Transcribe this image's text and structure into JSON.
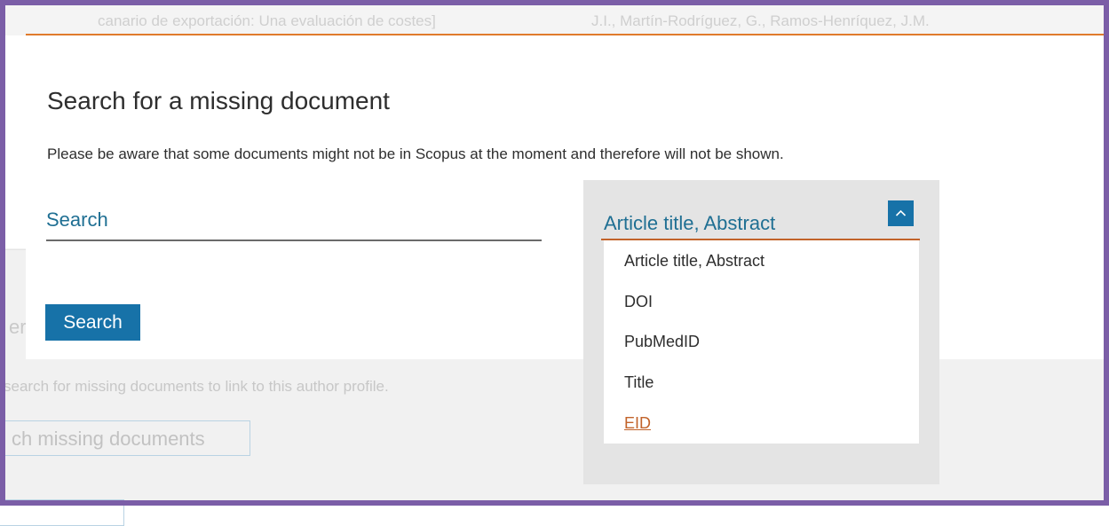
{
  "background": {
    "row_cells": [
      "canario de exportación: Una evaluación de costes]",
      "J.I., Martín-Rodríguez, G., Ramos-Henríquez, J.M."
    ],
    "heading_fragment": "er",
    "description": "search for missing documents to link to this author profile.",
    "button_label": "ch missing documents"
  },
  "modal": {
    "title": "Search for a missing document",
    "note": "Please be aware that some documents might not be in Scopus at the moment and therefore will not be shown.",
    "search_placeholder": "Search",
    "search_button": "Search"
  },
  "dropdown": {
    "selected": "Article title, Abstract",
    "toggle_icon": "chevron-up-icon",
    "options": [
      "Article title, Abstract",
      "DOI",
      "PubMedID",
      "Title",
      "EID"
    ],
    "highlighted": "EID"
  },
  "colors": {
    "accent_blue": "#1772a8",
    "link_blue": "#1f6f93",
    "accent_orange": "#c2632a",
    "frame_purple": "#7b5ea7"
  }
}
